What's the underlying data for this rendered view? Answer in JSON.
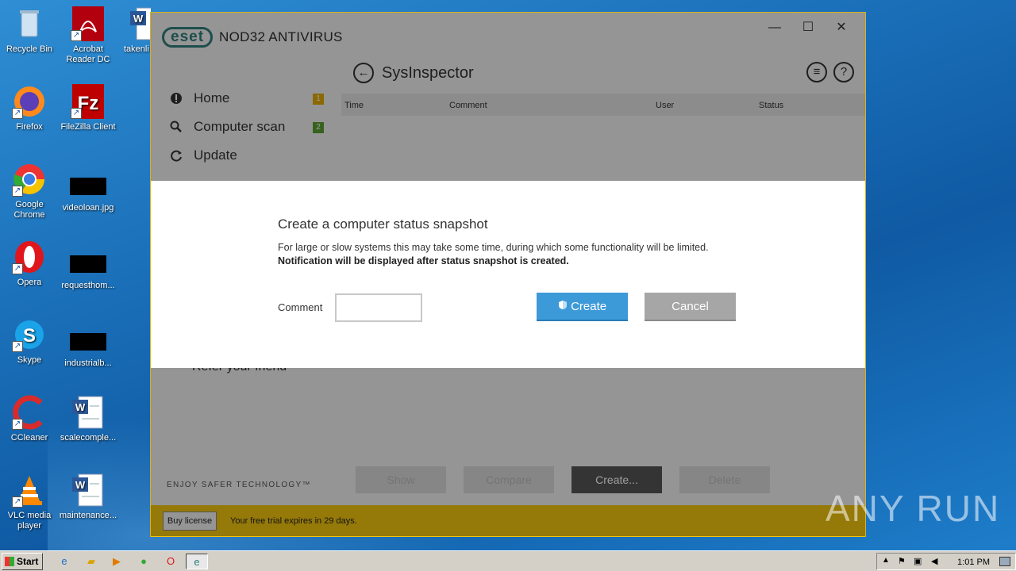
{
  "desktop": {
    "icons": [
      {
        "label": "Recycle Bin"
      },
      {
        "label": "Acrobat Reader DC"
      },
      {
        "label": "takenli"
      },
      {
        "label": "Firefox"
      },
      {
        "label": "FileZilla Client"
      },
      {
        "label": "Google Chrome"
      },
      {
        "label": "videoloan.jpg"
      },
      {
        "label": "Opera"
      },
      {
        "label": "requesthom..."
      },
      {
        "label": "Skype"
      },
      {
        "label": "industrialb..."
      },
      {
        "label": "CCleaner"
      },
      {
        "label": "scalecomple..."
      },
      {
        "label": "VLC media player"
      },
      {
        "label": "maintenance..."
      }
    ]
  },
  "app": {
    "logo": "eset",
    "title": "NOD32 ANTIVIRUS",
    "window_controls": {
      "minimize": "—",
      "maximize": "☐",
      "close": "✕"
    },
    "sidebar": [
      {
        "label": "Home",
        "icon": "alert-icon",
        "badge": "1",
        "badge_color": "#e0a800"
      },
      {
        "label": "Computer scan",
        "icon": "search-icon",
        "badge": "2",
        "badge_color": "#5a9e2f"
      },
      {
        "label": "Update",
        "icon": "refresh-icon"
      },
      {
        "label": "Refer your friend",
        "icon": "gift-icon"
      }
    ],
    "page_title": "SysInspector",
    "table_headers": [
      "Time",
      "Comment",
      "User",
      "Status"
    ],
    "tagline": "ENJOY SAFER TECHNOLOGY™",
    "bottom_buttons": [
      "Show",
      "Compare",
      "Create...",
      "Delete"
    ],
    "trial": {
      "buy_label": "Buy license",
      "text": "Your free trial expires in 29 days."
    }
  },
  "dialog": {
    "title": "Create a computer status snapshot",
    "text": "For large or slow systems this may take some time, during which some functionality will be limited.",
    "bold_text": "Notification will be displayed after status snapshot is created.",
    "comment_label": "Comment",
    "comment_value": "",
    "create_label": "Create",
    "cancel_label": "Cancel"
  },
  "watermark": "ANY RUN",
  "taskbar": {
    "start_label": "Start",
    "clock": "1:01 PM"
  },
  "colors": {
    "accent": "#3d9ad9",
    "trial_bar": "#f1c40f",
    "brand": "#2f7f7c"
  }
}
